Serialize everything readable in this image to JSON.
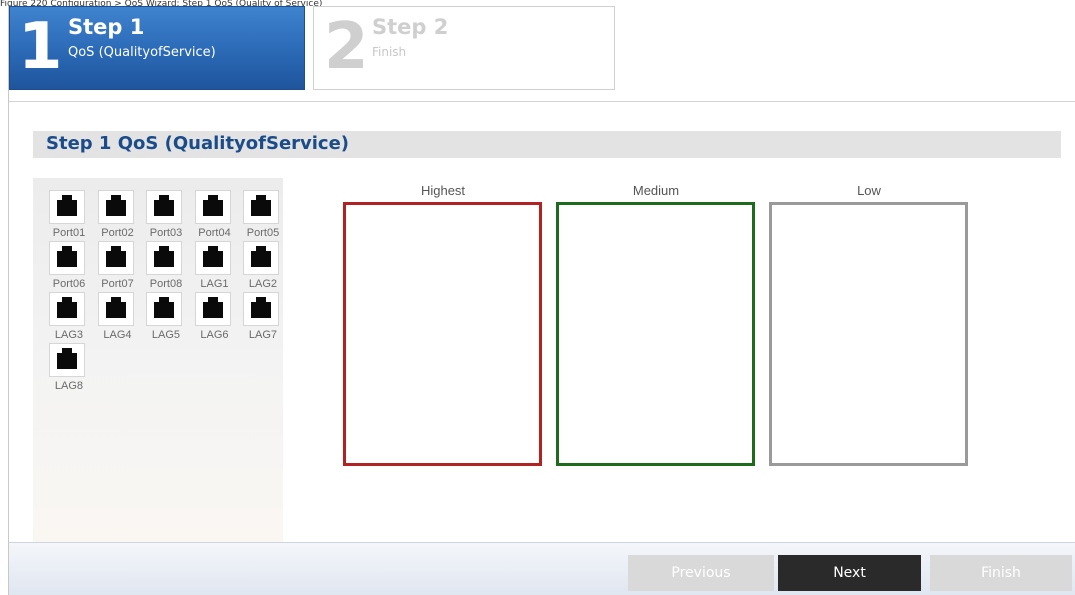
{
  "caption": "Figure 220  Configuration > QoS Wizard: Step 1 QoS (Quality of Service)",
  "steps": [
    {
      "number": "1",
      "title": "Step 1",
      "subtitle": "QoS (QualityofService)"
    },
    {
      "number": "2",
      "title": "Step 2",
      "subtitle": "Finish"
    }
  ],
  "section_title": "Step 1 QoS (QualityofService)",
  "ports": [
    "Port01",
    "Port02",
    "Port03",
    "Port04",
    "Port05",
    "Port06",
    "Port07",
    "Port08",
    "LAG1",
    "LAG2",
    "LAG3",
    "LAG4",
    "LAG5",
    "LAG6",
    "LAG7",
    "LAG8"
  ],
  "priorities": [
    {
      "label": "Highest",
      "color": "#b22222"
    },
    {
      "label": "Medium",
      "color": "#1e6b1e"
    },
    {
      "label": "Low",
      "color": "#9a9a9a"
    }
  ],
  "buttons": {
    "previous": "Previous",
    "next": "Next",
    "finish": "Finish"
  },
  "colors": {
    "accent": "#2b69b5",
    "section_title": "#1b4c8a"
  }
}
